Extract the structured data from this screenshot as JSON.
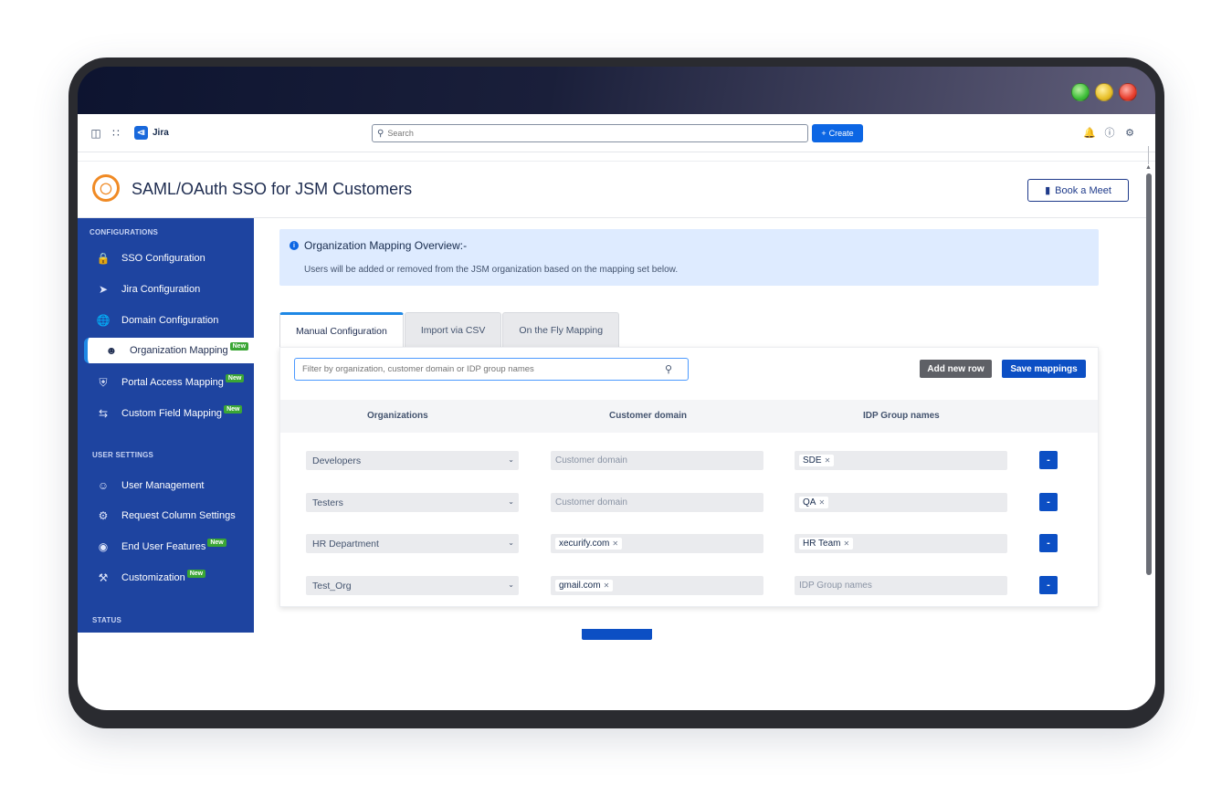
{
  "window": {
    "lights": [
      "green",
      "yellow",
      "red"
    ]
  },
  "topbar": {
    "app_name": "Jira",
    "search_placeholder": "Search",
    "create_label": "Create"
  },
  "plugin": {
    "title": "SAML/OAuth SSO for JSM Customers",
    "book_meet_label": "Book a Meet"
  },
  "sidebar": {
    "configurations_heading": "CONFIGURATIONS",
    "user_settings_heading": "USER SETTINGS",
    "status_heading": "STATUS",
    "badge_new": "New",
    "items": [
      {
        "label": "SSO Configuration"
      },
      {
        "label": "Jira Configuration"
      },
      {
        "label": "Domain Configuration"
      },
      {
        "label": "Organization Mapping"
      },
      {
        "label": "Portal Access Mapping"
      },
      {
        "label": "Custom Field Mapping"
      },
      {
        "label": "User Management"
      },
      {
        "label": "Request Column Settings"
      },
      {
        "label": "End User Features"
      },
      {
        "label": "Customization"
      }
    ]
  },
  "overview": {
    "title": "Organization Mapping Overview:-",
    "text": "Users will be added or removed from the JSM organization based on the mapping set below."
  },
  "tabs": [
    "Manual Configuration",
    "Import via CSV",
    "On the Fly Mapping"
  ],
  "toolbar": {
    "filter_placeholder": "Filter by organization, customer domain or IDP group names",
    "add_row_label": "Add new row",
    "save_label": "Save mappings"
  },
  "table": {
    "headers": [
      "Organizations",
      "Customer domain",
      "IDP Group names"
    ],
    "domain_placeholder": "Customer domain",
    "group_placeholder": "IDP Group names",
    "remove_label": "-",
    "rows": [
      {
        "organization": "Developers",
        "domain": "",
        "group": "SDE"
      },
      {
        "organization": "Testers",
        "domain": "",
        "group": "QA"
      },
      {
        "organization": "HR Department",
        "domain": "xecurify.com",
        "group": "HR Team"
      },
      {
        "organization": "Test_Org",
        "domain": "gmail.com",
        "group": ""
      }
    ]
  }
}
